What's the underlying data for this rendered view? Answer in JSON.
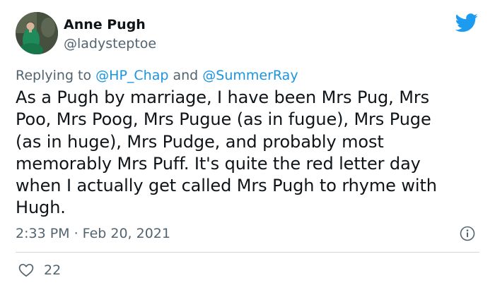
{
  "author": {
    "name": "Anne Pugh",
    "handle": "@ladysteptoe",
    "avatar": "profile-portrait-woman-green-dress"
  },
  "brand_icon": "twitter-bird-icon",
  "colors": {
    "brand": "#1d9bf0",
    "mention": "#1b95e0",
    "secondary_text": "#536471",
    "divider": "#cfd9de"
  },
  "reply": {
    "prefix": "Replying to",
    "mention_1": "@HP_Chap",
    "joiner": "and",
    "mention_2": "@SummerRay"
  },
  "tweet": {
    "lines": [
      "As a Pugh by marriage, I have been Mrs Pug, Mrs",
      "Poo, Mrs Poog, Mrs Pugue (as in fugue), Mrs Puge",
      "(as in huge), Mrs Pudge, and probably most",
      "memorably Mrs Puff.  It's quite the red letter day",
      "when I actually get called Mrs Pugh to rhyme with",
      "Hugh."
    ],
    "timestamp": "2:33 PM · Feb 20, 2021"
  },
  "engagement": {
    "likes": "22"
  }
}
